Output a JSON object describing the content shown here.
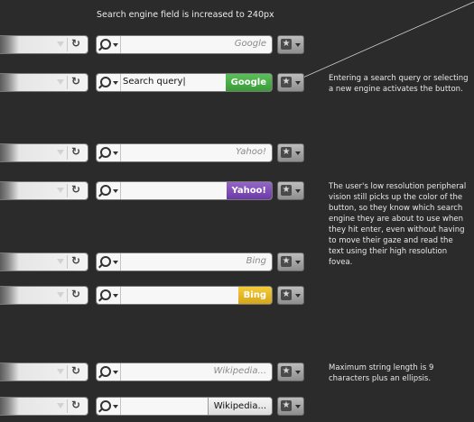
{
  "header": "Search engine field is increased to 240px",
  "rows": [
    {
      "placeholder": "Google",
      "query": "",
      "engine": ""
    },
    {
      "placeholder": "",
      "query": "Search query|",
      "engine": "Google"
    },
    {
      "placeholder": "Yahoo!",
      "query": "",
      "engine": ""
    },
    {
      "placeholder": "",
      "query": "",
      "engine": "Yahoo!"
    },
    {
      "placeholder": "Bing",
      "query": "",
      "engine": ""
    },
    {
      "placeholder": "",
      "query": "",
      "engine": "Bing"
    },
    {
      "placeholder": "Wikipedia...",
      "query": "",
      "engine": ""
    },
    {
      "placeholder": "",
      "query": "",
      "engine": "Wikipedia..."
    }
  ],
  "notes": {
    "activate": "Entering a search query or selecting a new engine activates the button.",
    "peripheral": "The user's low resolution peripheral vision still picks up the color of the button, so they know which search engine they are about to use when they hit enter, even without having to move their gaze and read the text using their high resolution fovea.",
    "maxlength": "Maximum string length is 9 characters plus an ellipsis."
  },
  "icons": {
    "dropdown": "triangle-down-icon",
    "reload": "reload-icon",
    "search": "magnifier-icon",
    "bookmark": "star-icon"
  },
  "colors": {
    "google": "#4caf4a",
    "yahoo": "#7d48b8",
    "bing": "#e0b52a"
  }
}
